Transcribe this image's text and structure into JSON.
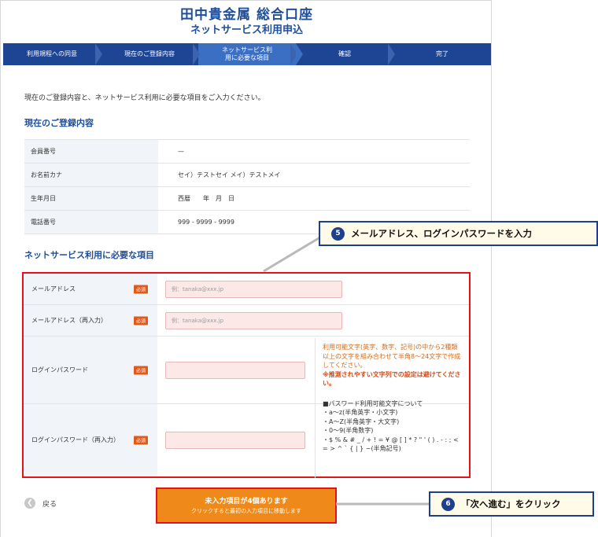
{
  "header": {
    "title": "田中貴金属 総合口座",
    "subtitle": "ネットサービス利用申込"
  },
  "steps": [
    {
      "label": "利用規程への同意"
    },
    {
      "label": "現在のご登録内容"
    },
    {
      "label": "ネットサービス利用に必要な項目",
      "active": true
    },
    {
      "label": "確認"
    },
    {
      "label": "完了"
    }
  ],
  "intro": "現在のご登録内容と、ネットサービス利用に必要な項目をご入力ください。",
  "section_current": "現在のご登録内容",
  "current": [
    {
      "label": "会員番号",
      "value": "—"
    },
    {
      "label": "お名前カナ",
      "value": "セイ）テストセイ メイ）テストメイ"
    },
    {
      "label": "生年月日",
      "value": "西暦　　年　月　日"
    },
    {
      "label": "電話番号",
      "value": "999 - 9999 - 9999"
    }
  ],
  "section_required": "ネットサービス利用に必要な項目",
  "required_badge": "必須",
  "form": {
    "email_label": "メールアドレス",
    "email_placeholder": "例：tanaka@xxx.jp",
    "email2_label": "メールアドレス（再入力）",
    "email2_placeholder": "例：tanaka@xxx.jp",
    "pass_label": "ログインパスワード",
    "pass2_label": "ログインパスワード（再入力）"
  },
  "password_note": {
    "rule": "利用可能文字(英字、数字、記号)の中から2種類以上の文字を組み合わせて半角8～24文字で作成してください。",
    "warning": "※推測されやすい文字列での設定は避けてください。",
    "chars_title": "■パスワード利用可能文字について",
    "chars": [
      "・a～z(半角英字・小文字)",
      "・A～Z(半角英字・大文字)",
      "・0～9(半角数字)",
      "・$ % & # _ / + ! = ¥ @ [ ] * ? \" ' ( ) . - : ; < = > ^ ` { | } ~(半角記号)"
    ]
  },
  "back_label": "戻る",
  "next_button": {
    "main": "未入力項目が4個あります",
    "sub": "クリックすると最初の入力項目に移動します"
  },
  "callouts": [
    {
      "number": "5",
      "text": "メールアドレス、ログインパスワードを入力"
    },
    {
      "number": "6",
      "text": "「次へ進む」をクリック"
    }
  ],
  "colors": {
    "brand": "#1f4e9a",
    "nav": "#1d4594",
    "highlight": "#e2141a",
    "button": "#ef8a1a",
    "input_error": "#fde8e8"
  }
}
